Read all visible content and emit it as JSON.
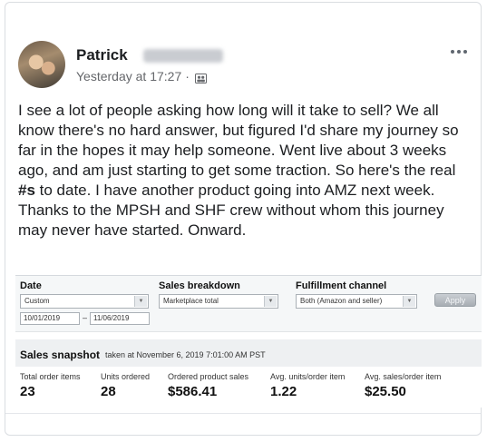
{
  "post": {
    "author_name": "Patrick",
    "timestamp": "Yesterday at 17:27",
    "separator": "·",
    "privacy_icon": "group-icon",
    "more_icon": "more-horizontal-icon",
    "body_before": "I see a lot of people asking how long will it take to sell?  We all know there's no hard answer, but figured I'd share my journey so far in the hopes it may help someone. Went live about 3 weeks ago, and am just starting to get some traction. So here's the real ",
    "body_bold": "#s",
    "body_after": " to date. I have another product going into AMZ next week. Thanks to the MPSH and SHF crew without whom this journey may never have started. Onward."
  },
  "report": {
    "filters": {
      "date_label": "Date",
      "date_range_value": "Custom",
      "date_from": "10/01/2019",
      "date_dash": "–",
      "date_to": "11/06/2019",
      "sales_breakdown_label": "Sales breakdown",
      "sales_breakdown_value": "Marketplace total",
      "fulfillment_label": "Fulfillment channel",
      "fulfillment_value": "Both (Amazon and seller)",
      "apply_label": "Apply"
    },
    "snapshot": {
      "title": "Sales snapshot",
      "taken_at": "taken at November 6, 2019 7:01:00 AM PST",
      "metrics": [
        {
          "label": "Total order items",
          "value": "23"
        },
        {
          "label": "Units ordered",
          "value": "28"
        },
        {
          "label": "Ordered product sales",
          "value": "$586.41"
        },
        {
          "label": "Avg. units/order item",
          "value": "1.22"
        },
        {
          "label": "Avg. sales/order item",
          "value": "$25.50"
        }
      ]
    }
  }
}
